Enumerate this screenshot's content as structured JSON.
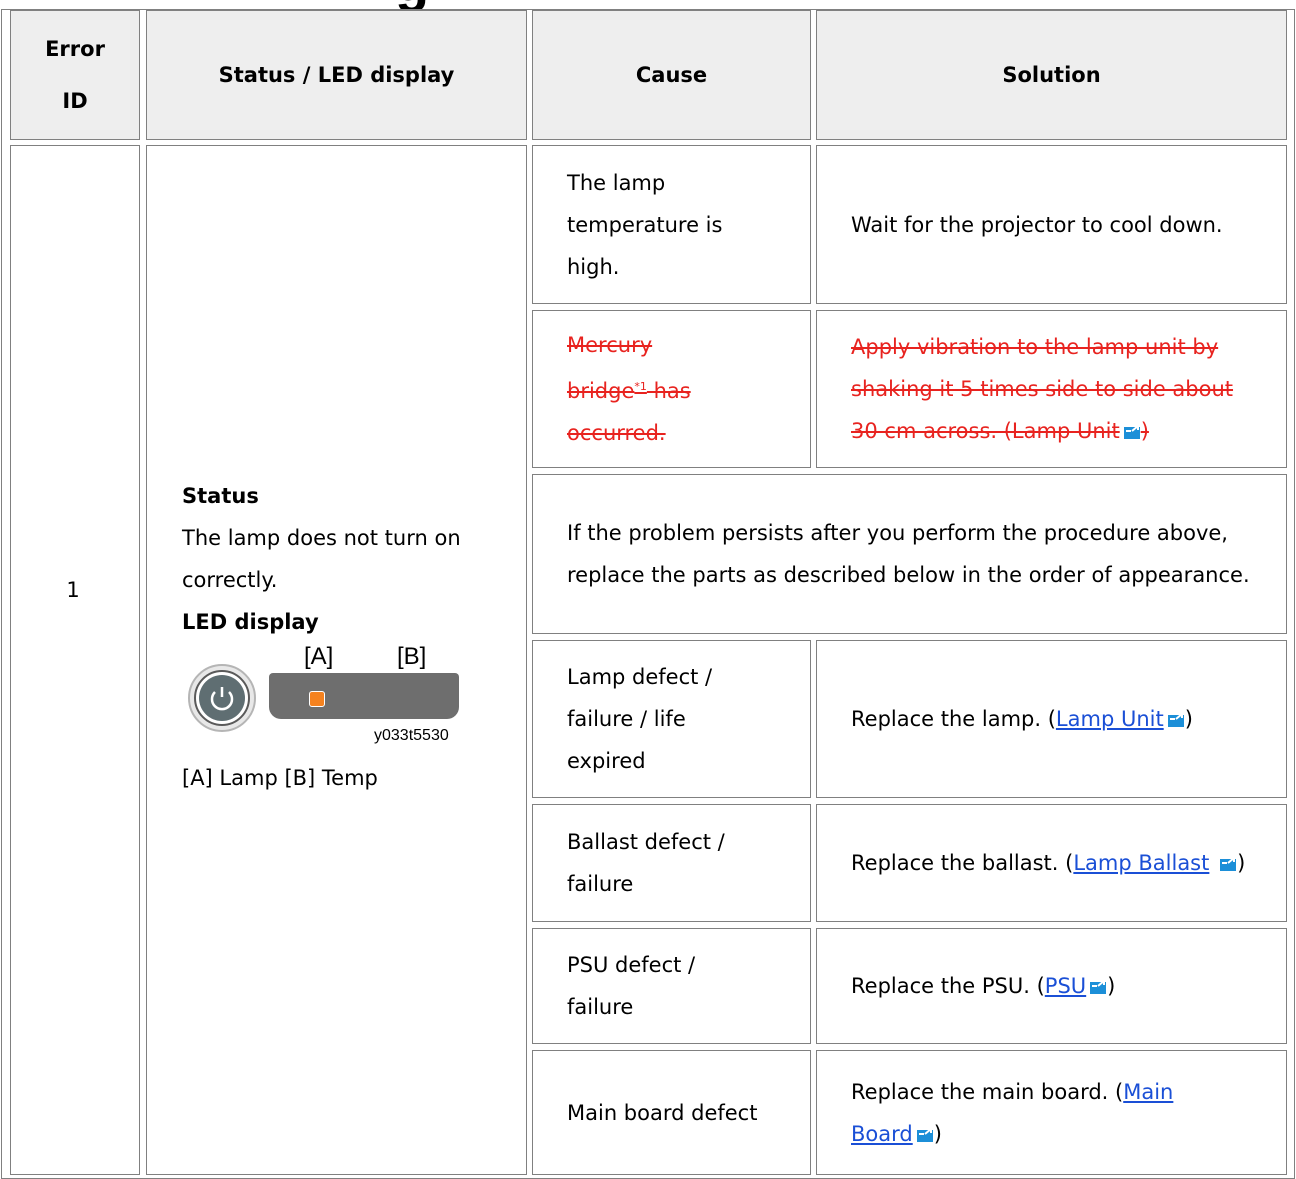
{
  "page_title_fragment": "g",
  "table": {
    "headers": {
      "error_id": "Error ID",
      "status_led": "Status / LED display",
      "cause": "Cause",
      "solution": "Solution"
    },
    "row": {
      "error_id": "1",
      "status_heading": "Status",
      "status_text": "The lamp does not turn on correctly.",
      "led_heading": "LED display",
      "led_figure": {
        "label_a": "[A]",
        "label_b": "[B]",
        "figure_id": "y033t5530",
        "lamp_led_color": "#f5821f"
      },
      "led_caption": "[A] Lamp [B] Temp",
      "causes": [
        {
          "cause": "The lamp temperature is high.",
          "solution": "Wait for the projector to cool down."
        },
        {
          "cause": "Mercury bridge",
          "cause_sup": "*1",
          "cause_end": " has occurred.",
          "solution": "Apply vibration to the lamp unit by shaking it 5 times side to side about 30 cm across. (Lamp Unit",
          "solution_end": ")"
        },
        {
          "note": "If the problem persists after you perform the procedure above, replace the parts as described below in the order of appearance."
        },
        {
          "cause": "Lamp defect / failure / life expired",
          "solution_pre": "Replace the lamp. (",
          "link": "Lamp Unit",
          "solution_end": ")"
        },
        {
          "cause": "Ballast defect / failure",
          "solution_pre": "Replace the ballast. (",
          "link": "Lamp Ballast",
          "solution_end": ")"
        },
        {
          "cause": "PSU defect / failure",
          "solution_pre": "Replace the PSU. (",
          "link": "PSU",
          "solution_end": ")"
        },
        {
          "cause": "Main board defect",
          "solution_pre": "Replace the main board. (",
          "link": "Main Board",
          "solution_end": ")"
        }
      ]
    }
  },
  "colors": {
    "header_bg": "#eeeeee",
    "border": "#808080",
    "deleted_text": "#e8231f",
    "link": "#1a4fd6"
  },
  "icons": {
    "external_link": "external-link-icon",
    "power": "power-icon"
  }
}
